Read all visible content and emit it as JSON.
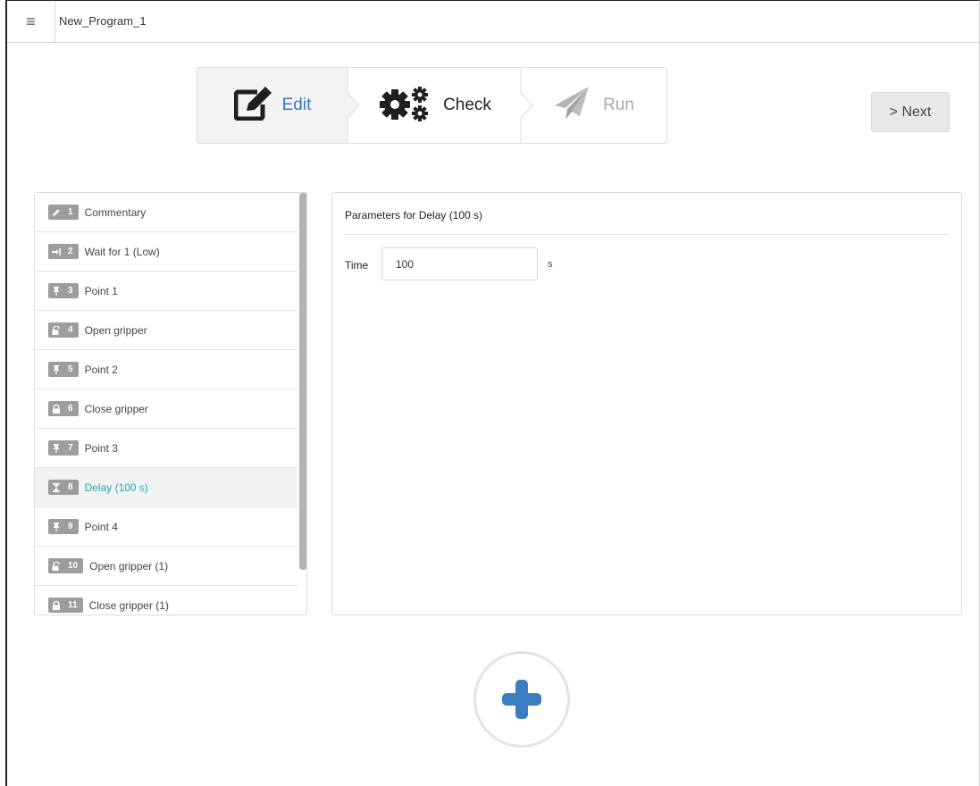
{
  "header": {
    "menu_icon": "hamburger-icon",
    "program_name": "New_Program_1"
  },
  "wizard": {
    "steps": [
      {
        "label": "Edit",
        "icon": "edit-icon",
        "state": "active",
        "color": "#3a7ab8"
      },
      {
        "label": "Check",
        "icon": "gears-icon",
        "state": "normal",
        "color": "#222222"
      },
      {
        "label": "Run",
        "icon": "paper-plane-icon",
        "state": "disabled",
        "color": "#a9a9a9"
      }
    ],
    "next_label": "> Next"
  },
  "commands": [
    {
      "num": "1",
      "icon": "pencil-icon",
      "label": "Commentary"
    },
    {
      "num": "2",
      "icon": "sign-in-icon",
      "label": "Wait for 1 (Low)"
    },
    {
      "num": "3",
      "icon": "pin-icon",
      "label": "Point 1"
    },
    {
      "num": "4",
      "icon": "unlock-icon",
      "label": "Open gripper"
    },
    {
      "num": "5",
      "icon": "pin-icon",
      "label": "Point 2"
    },
    {
      "num": "6",
      "icon": "lock-icon",
      "label": "Close gripper"
    },
    {
      "num": "7",
      "icon": "pin-icon",
      "label": "Point 3"
    },
    {
      "num": "8",
      "icon": "hourglass-icon",
      "label": "Delay (100 s)",
      "selected": true
    },
    {
      "num": "9",
      "icon": "pin-icon",
      "label": "Point 4"
    },
    {
      "num": "10",
      "icon": "unlock-icon",
      "label": "Open gripper (1)"
    },
    {
      "num": "11",
      "icon": "lock-icon",
      "label": "Close gripper (1)"
    }
  ],
  "params": {
    "title": "Parameters for  Delay (100 s)",
    "time_label": "Time",
    "time_value": "100",
    "time_unit": "s"
  },
  "add_button": {
    "icon": "plus-icon",
    "color": "#3b7dc0"
  },
  "colors": {
    "accent": "#3a7ab8",
    "selected_text": "#2aa6b5",
    "badge": "#9d9d9d"
  }
}
